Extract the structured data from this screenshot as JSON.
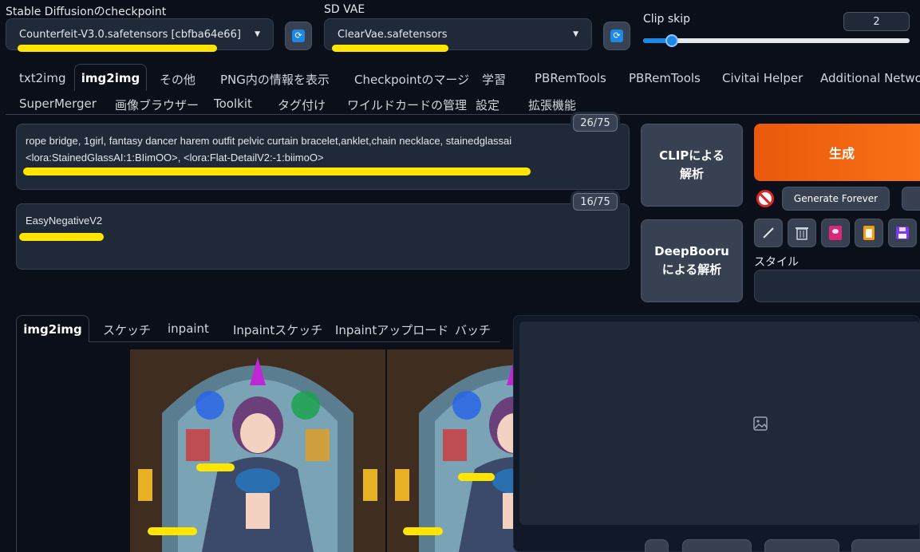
{
  "checkpoint": {
    "label": "Stable Diffusionのcheckpoint",
    "value": "Counterfeit-V3.0.safetensors [cbfba64e66]"
  },
  "vae": {
    "label": "SD VAE",
    "value": "ClearVae.safetensors"
  },
  "clip_skip": {
    "label": "Clip skip",
    "value": "2",
    "fraction": 0.11
  },
  "tabs_row1": [
    "txt2img",
    "img2img",
    "その他",
    "PNG内の情報を表示",
    "Checkpointのマージ",
    "学習",
    "PBRemTools",
    "PBRemTools",
    "Civitai Helper",
    "Additional Network"
  ],
  "tabs_row2": [
    "SuperMerger",
    "画像ブラウザー",
    "Toolkit",
    "タグ付け",
    "ワイルドカードの管理",
    "設定",
    "拡張機能"
  ],
  "active_tab": "img2img",
  "prompt": {
    "counter": "26/75",
    "line1": "rope bridge, 1girl, fantasy dancer harem outfit pelvic curtain bracelet,anklet,chain necklace, stainedglassai",
    "line2": "<lora:StainedGlassAI:1:BIimOO>, <lora:Flat-DetailV2:-1:biimoO>"
  },
  "negative_prompt": {
    "counter": "16/75",
    "text": "EasyNegativeV2"
  },
  "buttons": {
    "clip_interrogate": "CLIPによる解析",
    "deepbooru": "DeepBooruによる解析",
    "generate": "生成",
    "generate_forever": "Generate Forever"
  },
  "style": {
    "label": "スタイル"
  },
  "img_tabs": [
    "img2img",
    "スケッチ",
    "inpaint",
    "Inpaintスケッチ",
    "Inpaintアップロード",
    "バッチ"
  ],
  "active_img_tab": "img2img",
  "icons": [
    "refresh-icon",
    "stop-icon",
    "pencil-icon",
    "trash-icon",
    "save-style-icon",
    "clipboard-icon",
    "floppy-icon",
    "image-placeholder-icon"
  ],
  "colors": {
    "generate": "#f97316",
    "highlight": "#ffe500",
    "accent": "#1e88e5",
    "background": "#0b0f19"
  }
}
